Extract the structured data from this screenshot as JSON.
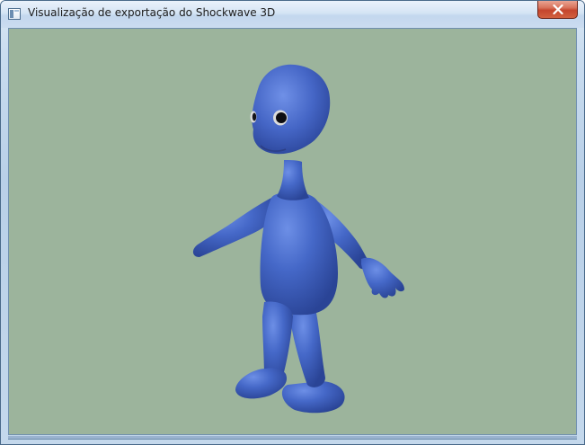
{
  "window": {
    "title": "Visualização de exportação do Shockwave 3D",
    "icon": "app-window-icon",
    "close_icon": "close-icon"
  },
  "viewport": {
    "background_color": "#9cb49c",
    "model": {
      "name": "blue-alien-character",
      "body_color": "#3f63c4"
    }
  },
  "colors": {
    "titlebar": "#cbdcf0",
    "close_button": "#c4452d",
    "frame": "#b9d0e8"
  }
}
